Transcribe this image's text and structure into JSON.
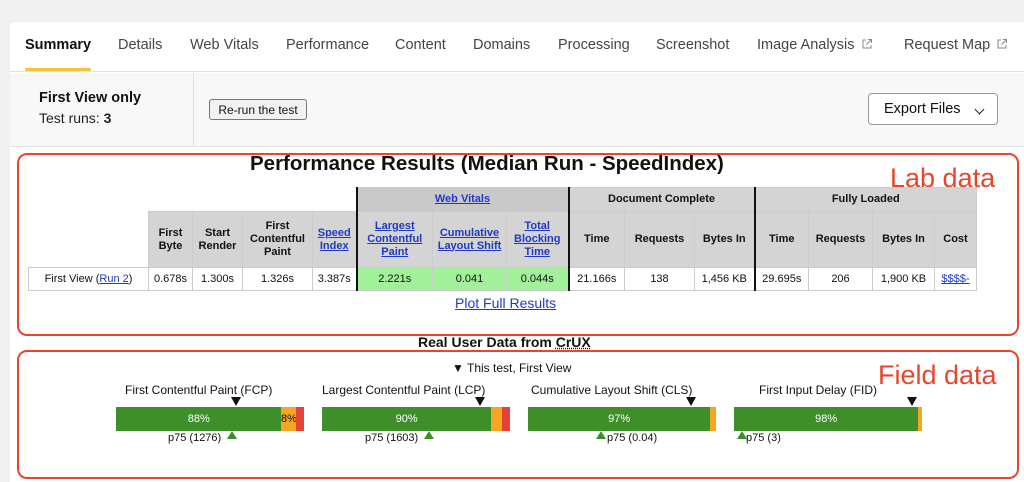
{
  "tabs": [
    {
      "label": "Summary"
    },
    {
      "label": "Details"
    },
    {
      "label": "Web Vitals"
    },
    {
      "label": "Performance"
    },
    {
      "label": "Content"
    },
    {
      "label": "Domains"
    },
    {
      "label": "Processing"
    },
    {
      "label": "Screenshot"
    },
    {
      "label": "Image Analysis"
    },
    {
      "label": "Request Map"
    }
  ],
  "active_tab": "Summary",
  "run_info": {
    "view_label": "First View only",
    "runs_prefix": "Test runs:",
    "runs_count": "3",
    "rerun_label": "Re-run the test",
    "export_label": "Export Files"
  },
  "lab": {
    "tag": "Lab data",
    "title": "Performance Results (Median Run - SpeedIndex)",
    "group_headers": {
      "web_vitals": "Web Vitals",
      "document_complete": "Document Complete",
      "fully_loaded": "Fully Loaded"
    },
    "columns": [
      {
        "label": "First Byte",
        "html": "First<br>Byte"
      },
      {
        "label": "Start Render"
      },
      {
        "label": "First Contentful Paint"
      },
      {
        "label": "Speed Index"
      },
      {
        "label": "Largest Contentful Paint"
      },
      {
        "label": "Cumulative Layout Shift"
      },
      {
        "label": "Total Blocking Time"
      },
      {
        "label": "Time"
      },
      {
        "label": "Requests"
      },
      {
        "label": "Bytes In"
      },
      {
        "label": "Time"
      },
      {
        "label": "Requests"
      },
      {
        "label": "Bytes In"
      },
      {
        "label": "Cost"
      }
    ],
    "row": {
      "label_prefix": "First View (",
      "run_link": "Run 2",
      "label_suffix": ")",
      "values": [
        "0.678s",
        "1.300s",
        "1.326s",
        "3.387s",
        "2.221s",
        "0.041",
        "0.044s",
        "21.166s",
        "138",
        "1,456 KB",
        "29.695s",
        "206",
        "1,900 KB",
        "$$$$-"
      ]
    },
    "plot_link": "Plot Full Results"
  },
  "field": {
    "tag": "Field data",
    "title_prefix": "Real User Data from ",
    "title_source": "CrUX",
    "this_test": "▼ This test, First View",
    "metrics": [
      {
        "label": "First Contentful Paint (FCP)",
        "good_pct": 88,
        "ni_pct": 8,
        "poor_pct": 4,
        "good_text": "88%",
        "ni_text": "8%",
        "p75": "p75 (1276)"
      },
      {
        "label": "Largest Contentful Paint (LCP)",
        "good_pct": 90,
        "ni_pct": 6,
        "poor_pct": 4,
        "good_text": "90%",
        "ni_text": "",
        "p75": "p75 (1603)"
      },
      {
        "label": "Cumulative Layout Shift (CLS)",
        "good_pct": 97,
        "ni_pct": 3,
        "poor_pct": 0,
        "good_text": "97%",
        "ni_text": "",
        "p75": "p75 (0.04)"
      },
      {
        "label": "First Input Delay (FID)",
        "good_pct": 98,
        "ni_pct": 2,
        "poor_pct": 0,
        "good_text": "98%",
        "ni_text": "",
        "p75": "p75 (3)"
      }
    ]
  },
  "colors": {
    "accent_underline": "#f5c43a",
    "annotation_red": "#e8452c",
    "good": "#3e8f2a",
    "needs_improvement": "#f5a623",
    "poor": "#e4433a",
    "web_vitals_highlight": "#a3f09b",
    "link": "#1f39c5"
  },
  "icons": {
    "external_link": "external-link-icon",
    "export_chevron": "chevron-down-icon"
  }
}
